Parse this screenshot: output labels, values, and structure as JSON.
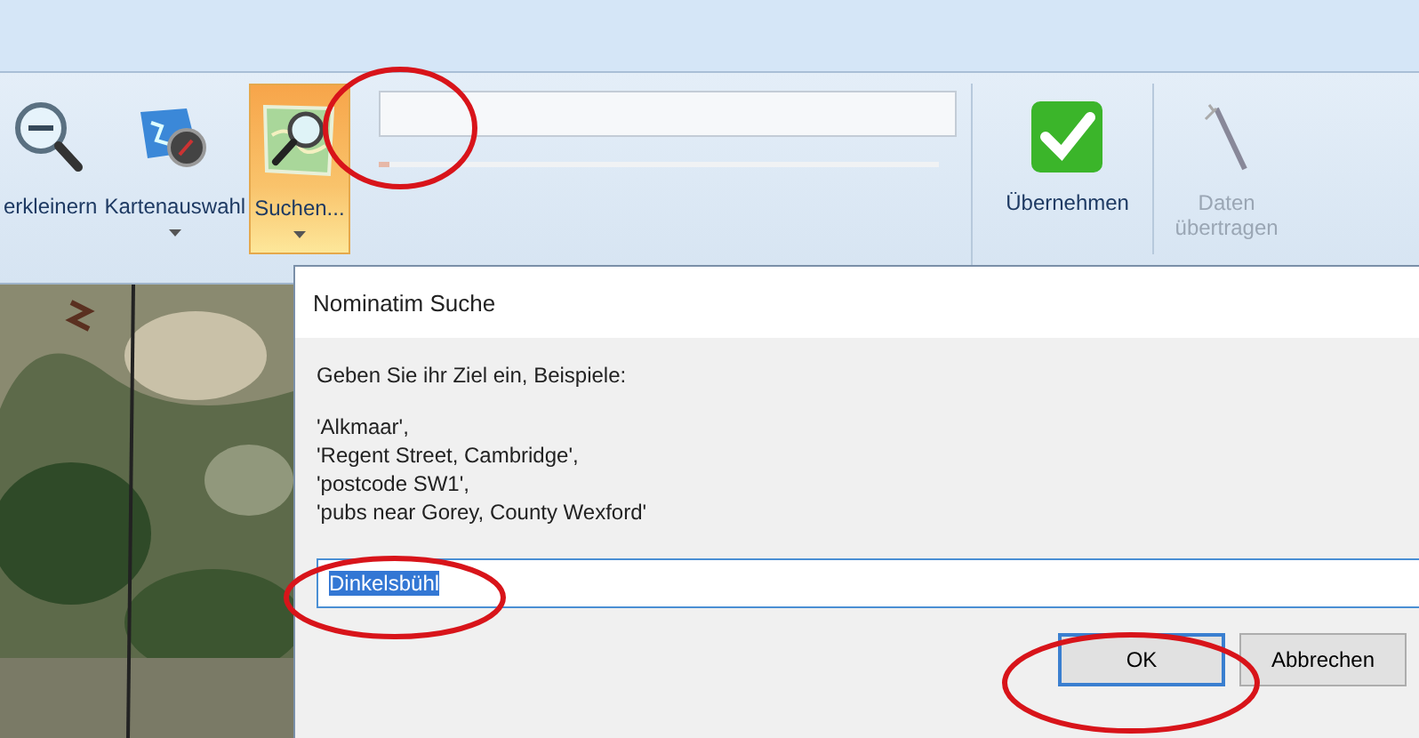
{
  "ribbon": {
    "buttons": [
      {
        "label": "erkleinern",
        "dropdown": false,
        "selected": false,
        "disabled": false
      },
      {
        "label": "Kartenauswahl",
        "dropdown": true,
        "selected": false,
        "disabled": false
      },
      {
        "label": "Suchen...",
        "dropdown": true,
        "selected": true,
        "disabled": false
      }
    ],
    "view_group": {
      "level": 0.02
    },
    "apply_button": {
      "label": "Übernehmen",
      "disabled": false
    },
    "transfer_button": {
      "label": "Daten übertragen",
      "disabled": true
    }
  },
  "dialog": {
    "title": "Nominatim Suche",
    "prompt": "Geben Sie ihr Ziel ein, Beispiele:",
    "examples": [
      "'Alkmaar',",
      "'Regent Street, Cambridge',",
      "'postcode SW1',",
      "'pubs near Gorey, County Wexford'"
    ],
    "value": "Dinkelsbühl",
    "value_selected": true,
    "buttons": [
      {
        "label": "OK",
        "default": true
      },
      {
        "label": "Abbrechen",
        "default": false
      }
    ]
  }
}
